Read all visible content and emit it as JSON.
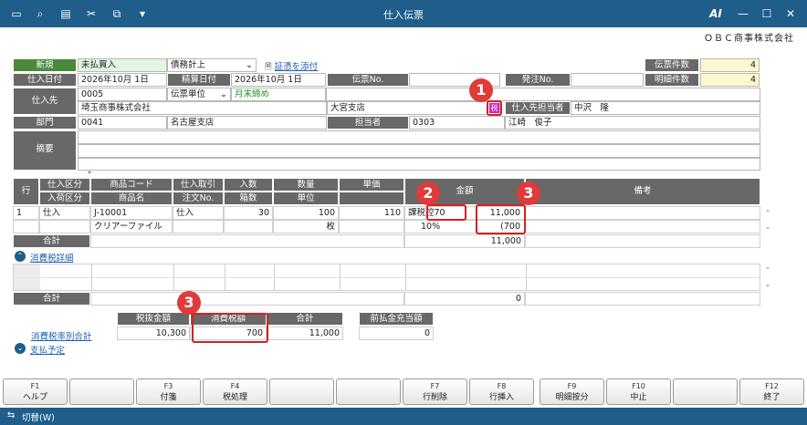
{
  "window": {
    "title": "仕入伝票"
  },
  "company": "ＯＢＣ商事株式会社",
  "header": {
    "new_label": "新規",
    "type_value": "未払買入",
    "debt_value": "債務計上",
    "attach_link": "証憑を添付",
    "slip_count_label": "伝票件数",
    "slip_count": "4",
    "detail_count_label": "明細件数",
    "detail_count": "4",
    "date_label": "仕入日付",
    "date_value": "2026年10月 1日",
    "settle_label": "精算日付",
    "settle_value": "2026年10月 1日",
    "slip_no_label": "伝票No.",
    "slip_no_value": "",
    "order_no_label": "発注No.",
    "order_no_value": "",
    "supplier_label": "仕入先",
    "supplier_code": "0005",
    "unit_value": "伝票単位",
    "closing_value": "月末締め",
    "supplier_name": "埼玉商事株式会社",
    "branch_name": "大宮支店",
    "tax_badge": "税",
    "contact_label": "仕入先担当者",
    "contact_value": "中沢　隆",
    "dept_label": "部門",
    "dept_code": "0041",
    "dept_name": "名古屋支店",
    "staff_label": "担当者",
    "staff_code": "0303",
    "staff_name": "江崎　俊子",
    "memo_label": "摘要"
  },
  "grid": {
    "row_header": "行",
    "headers_top": [
      "仕入区分",
      "商品コード",
      "仕入取引",
      "入数",
      "数量",
      "単価",
      "金額",
      "備考"
    ],
    "headers_bottom": [
      "入荷区分",
      "商品名",
      "注文No.",
      "箱数",
      "単位"
    ],
    "row": {
      "no": "1",
      "kubun": "仕入",
      "code": "J-10001",
      "torihiki": "仕入",
      "irisu": "30",
      "qty": "100",
      "price": "110",
      "tax_note": "課税",
      "tax_inner": "控70",
      "amount": "11,000",
      "name": "クリアーファイル",
      "unit": "枚",
      "rate": "10%",
      "tax_amount": "(700"
    },
    "total_label": "合計",
    "total_value": "11,000"
  },
  "tax_detail": {
    "link": "消費税詳細",
    "total_label": "合計",
    "total_value": "0"
  },
  "summary": {
    "rate_total_link": "消費税率別合計",
    "headers": [
      "税抜金額",
      "消費税額",
      "合計"
    ],
    "values": [
      "10,300",
      "700",
      "11,000"
    ],
    "advance_label": "前払金充当額",
    "advance_value": "0",
    "payment_link": "支払予定"
  },
  "badges": [
    "1",
    "2",
    "3",
    "3"
  ],
  "fkeys": [
    {
      "key": "F1",
      "label": "ヘルプ"
    },
    {
      "key": "",
      "label": ""
    },
    {
      "key": "F3",
      "label": "付箋"
    },
    {
      "key": "F4",
      "label": "税処理"
    },
    {
      "key": "",
      "label": ""
    },
    {
      "key": "",
      "label": ""
    },
    {
      "key": "F7",
      "label": "行削除"
    },
    {
      "key": "F8",
      "label": "行挿入"
    },
    {
      "key": "F9",
      "label": "明細按分"
    },
    {
      "key": "F10",
      "label": "中止"
    },
    {
      "key": "",
      "label": ""
    },
    {
      "key": "F12",
      "label": "終了"
    }
  ],
  "status": {
    "switch_label": "切替(W)"
  },
  "logo_text": "AI"
}
